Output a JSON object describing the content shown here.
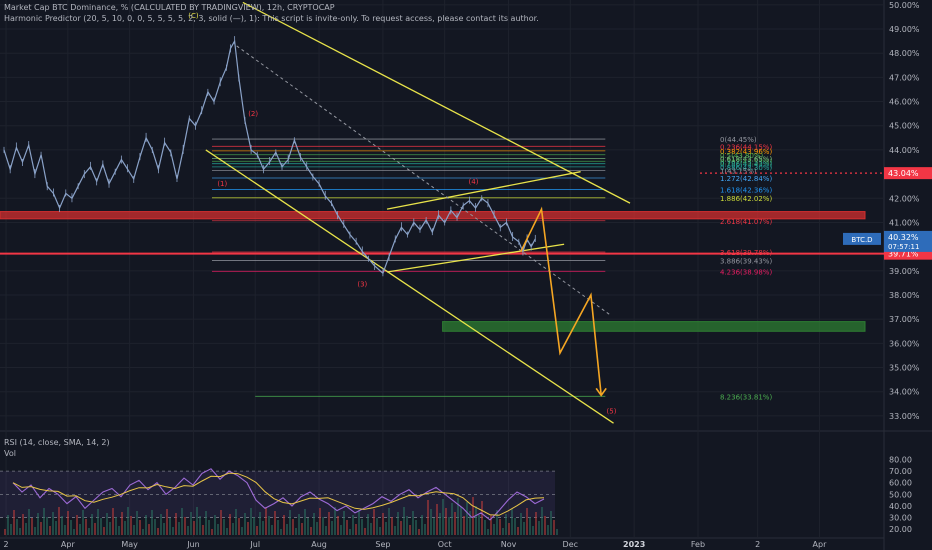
{
  "header": {
    "title": "Market Cap BTC Dominance, % (CALCULATED BY TRADINGVIEW), 12h, CRYPTOCAP",
    "indicator": "Harmonic Predictor (20, 5, 10, 0, 0, 5, 5, 5, 5, 2, 3, solid (—), 1): This script is invite-only. To request access, please contact its author.",
    "rsi_label": "RSI (14, close, SMA, 14, 2)",
    "vol_label": "Vol"
  },
  "colors": {
    "background": "#131722",
    "grid": "#1e222d",
    "price_line": "#8aa2c8",
    "channel": "#e8e34a",
    "projection": "#f5a623",
    "resistance_zone": "#d32f2f",
    "support_zone": "#2e7d32",
    "current_price_tag": "#2e6cba",
    "alert_line": "#f23645",
    "rsi_line": "#9c6ad6",
    "rsi_ma": "#e8c547"
  },
  "chart_data": {
    "type": "line",
    "symbol": "BTC.D",
    "timeframe": "12h",
    "price_axis": {
      "min": 32.5,
      "max": 50.2,
      "ticks": [
        "50.00%",
        "49.00%",
        "48.00%",
        "47.00%",
        "46.00%",
        "45.00%",
        "44.00%",
        "42.00%",
        "41.00%",
        "39.00%",
        "38.00%",
        "37.00%",
        "36.00%",
        "35.00%",
        "34.00%",
        "33.00%"
      ]
    },
    "time_axis": {
      "labels": [
        "2",
        "Apr",
        "May",
        "Jun",
        "Jul",
        "Aug",
        "Sep",
        "Oct",
        "Nov",
        "Dec",
        "2023",
        "Feb",
        "2",
        "Apr"
      ]
    },
    "current_price": {
      "label": "BTC.D",
      "value": "40.32%",
      "countdown": "07:57:11",
      "y": 40.32
    },
    "tagged_levels": [
      {
        "value": "43.04%",
        "y": 43.04,
        "style": "dotted-red"
      },
      {
        "value": "39.71%",
        "y": 39.71,
        "style": "solid-red"
      }
    ],
    "fib_levels": [
      {
        "label": "0(44.45%)",
        "y": 44.45,
        "color": "#9598a1"
      },
      {
        "label": "0.236(44.15%)",
        "y": 44.15,
        "color": "#f23645"
      },
      {
        "label": "0.382(43.96%)",
        "y": 43.96,
        "color": "#ff9800"
      },
      {
        "label": "0.5(43.80%)",
        "y": 43.8,
        "color": "#4caf50"
      },
      {
        "label": "0.618(43.65%)",
        "y": 43.65,
        "color": "#81c784"
      },
      {
        "label": "0.707(43.53%)",
        "y": 43.53,
        "color": "#4caf50"
      },
      {
        "label": "0.786(43.43%)",
        "y": 43.43,
        "color": "#26a69a"
      },
      {
        "label": "0.886(43.30%)",
        "y": 43.3,
        "color": "#26a69a"
      },
      {
        "label": "1(43.15%)",
        "y": 43.15,
        "color": "#9598a1"
      },
      {
        "label": "1.272(42.84%)",
        "y": 42.84,
        "color": "#42a5f5"
      },
      {
        "label": "1.618(42.36%)",
        "y": 42.36,
        "color": "#2196f3"
      },
      {
        "label": "1.886(42.02%)",
        "y": 42.02,
        "color": "#cddc39"
      },
      {
        "label": "2.618(41.07%)",
        "y": 41.07,
        "color": "#f23645"
      },
      {
        "label": "3.618(39.78%)",
        "y": 39.78,
        "color": "#f23645"
      },
      {
        "label": "3.886(39.43%)",
        "y": 39.43,
        "color": "#9598a1"
      },
      {
        "label": "4.236(38.98%)",
        "y": 38.98,
        "color": "#e91e63"
      },
      {
        "label": "8.236(33.81%)",
        "y": 33.81,
        "color": "#4caf50"
      }
    ],
    "zones": [
      {
        "name": "resistance",
        "y_top": 41.45,
        "y_bottom": 41.15,
        "color": "#d32f2f"
      },
      {
        "name": "support",
        "y_top": 36.9,
        "y_bottom": 36.5,
        "color": "#2e7d32"
      }
    ],
    "wave_labels": [
      {
        "label": "(C)",
        "x_date": "2022-06-01",
        "y": 49.45,
        "color": "#e8e34a"
      },
      {
        "label": "(2)",
        "x_date": "2022-06-30",
        "y": 45.4,
        "color": "#f23645"
      },
      {
        "label": "(1)",
        "x_date": "2022-06-15",
        "y": 42.5,
        "color": "#f23645"
      },
      {
        "label": "(4)",
        "x_date": "2022-10-15",
        "y": 42.6,
        "color": "#f23645"
      },
      {
        "label": "(3)",
        "x_date": "2022-08-22",
        "y": 38.35,
        "color": "#f23645"
      },
      {
        "label": "(5)",
        "x_date": "2022-12-21",
        "y": 33.1,
        "color": "#f23645"
      }
    ],
    "channel_lines": [
      {
        "name": "upper",
        "points": [
          [
            "2022-06-25",
            50.1
          ],
          [
            "2022-12-30",
            41.8
          ]
        ]
      },
      {
        "name": "lower",
        "points": [
          [
            "2022-06-07",
            44.0
          ],
          [
            "2022-12-22",
            32.7
          ]
        ]
      },
      {
        "name": "inner-lower",
        "points": [
          [
            "2022-09-03",
            38.95
          ],
          [
            "2022-11-28",
            40.1
          ]
        ]
      },
      {
        "name": "inner-upper",
        "points": [
          [
            "2022-09-03",
            41.55
          ],
          [
            "2022-12-06",
            43.1
          ]
        ]
      }
    ],
    "projection_path": [
      [
        "2022-11-07",
        39.8
      ],
      [
        "2022-11-17",
        41.55
      ],
      [
        "2022-11-26",
        35.6
      ],
      [
        "2022-12-11",
        38.0
      ],
      [
        "2022-12-16",
        33.85
      ]
    ],
    "price_series": [
      [
        "2022-03-01",
        44.0
      ],
      [
        "2022-03-04",
        43.2
      ],
      [
        "2022-03-07",
        44.1
      ],
      [
        "2022-03-10",
        43.5
      ],
      [
        "2022-03-13",
        44.2
      ],
      [
        "2022-03-16",
        43.0
      ],
      [
        "2022-03-19",
        43.8
      ],
      [
        "2022-03-22",
        42.5
      ],
      [
        "2022-03-25",
        42.2
      ],
      [
        "2022-03-28",
        41.6
      ],
      [
        "2022-03-31",
        42.2
      ],
      [
        "2022-04-03",
        42.0
      ],
      [
        "2022-04-06",
        42.5
      ],
      [
        "2022-04-09",
        43.0
      ],
      [
        "2022-04-12",
        43.3
      ],
      [
        "2022-04-15",
        42.7
      ],
      [
        "2022-04-18",
        43.4
      ],
      [
        "2022-04-21",
        42.6
      ],
      [
        "2022-04-24",
        43.1
      ],
      [
        "2022-04-27",
        43.6
      ],
      [
        "2022-04-30",
        43.2
      ],
      [
        "2022-05-03",
        42.8
      ],
      [
        "2022-05-06",
        43.7
      ],
      [
        "2022-05-09",
        44.5
      ],
      [
        "2022-05-12",
        44.0
      ],
      [
        "2022-05-15",
        43.2
      ],
      [
        "2022-05-18",
        44.3
      ],
      [
        "2022-05-21",
        43.9
      ],
      [
        "2022-05-24",
        42.8
      ],
      [
        "2022-05-27",
        44.0
      ],
      [
        "2022-05-30",
        45.3
      ],
      [
        "2022-06-02",
        45.0
      ],
      [
        "2022-06-05",
        45.6
      ],
      [
        "2022-06-08",
        46.4
      ],
      [
        "2022-06-11",
        46.0
      ],
      [
        "2022-06-14",
        46.8
      ],
      [
        "2022-06-17",
        47.4
      ],
      [
        "2022-06-19",
        48.2
      ],
      [
        "2022-06-21",
        48.5
      ],
      [
        "2022-06-23",
        47.0
      ],
      [
        "2022-06-26",
        45.2
      ],
      [
        "2022-06-29",
        44.0
      ],
      [
        "2022-07-02",
        43.8
      ],
      [
        "2022-07-05",
        43.2
      ],
      [
        "2022-07-08",
        43.5
      ],
      [
        "2022-07-11",
        43.9
      ],
      [
        "2022-07-14",
        43.3
      ],
      [
        "2022-07-17",
        43.6
      ],
      [
        "2022-07-20",
        44.4
      ],
      [
        "2022-07-23",
        43.7
      ],
      [
        "2022-07-26",
        43.3
      ],
      [
        "2022-07-29",
        42.9
      ],
      [
        "2022-08-01",
        42.6
      ],
      [
        "2022-08-04",
        42.1
      ],
      [
        "2022-08-07",
        41.8
      ],
      [
        "2022-08-10",
        41.3
      ],
      [
        "2022-08-13",
        40.9
      ],
      [
        "2022-08-16",
        40.5
      ],
      [
        "2022-08-19",
        40.2
      ],
      [
        "2022-08-22",
        39.8
      ],
      [
        "2022-08-25",
        39.5
      ],
      [
        "2022-08-28",
        39.2
      ],
      [
        "2022-09-01",
        38.9
      ],
      [
        "2022-09-04",
        39.6
      ],
      [
        "2022-09-07",
        40.3
      ],
      [
        "2022-09-10",
        40.8
      ],
      [
        "2022-09-13",
        40.5
      ],
      [
        "2022-09-16",
        41.0
      ],
      [
        "2022-09-19",
        40.7
      ],
      [
        "2022-09-22",
        41.1
      ],
      [
        "2022-09-25",
        40.6
      ],
      [
        "2022-09-28",
        41.3
      ],
      [
        "2022-10-01",
        41.0
      ],
      [
        "2022-10-04",
        41.5
      ],
      [
        "2022-10-07",
        41.2
      ],
      [
        "2022-10-10",
        41.7
      ],
      [
        "2022-10-13",
        41.9
      ],
      [
        "2022-10-16",
        41.6
      ],
      [
        "2022-10-19",
        42.0
      ],
      [
        "2022-10-22",
        41.8
      ],
      [
        "2022-10-25",
        41.3
      ],
      [
        "2022-10-28",
        40.8
      ],
      [
        "2022-10-31",
        41.0
      ],
      [
        "2022-11-03",
        40.4
      ],
      [
        "2022-11-06",
        40.2
      ],
      [
        "2022-11-08",
        39.8
      ],
      [
        "2022-11-10",
        40.3
      ],
      [
        "2022-11-12",
        40.0
      ],
      [
        "2022-11-14",
        40.32
      ]
    ],
    "rsi": {
      "axis_ticks": [
        "80.00",
        "70.00",
        "60.00",
        "50.00",
        "40.00",
        "30.00",
        "20.00"
      ],
      "min": 15,
      "max": 83,
      "series": [
        [
          3,
          60
        ],
        [
          6,
          52
        ],
        [
          9,
          58
        ],
        [
          12,
          47
        ],
        [
          15,
          55
        ],
        [
          18,
          50
        ],
        [
          21,
          42
        ],
        [
          24,
          48
        ],
        [
          27,
          38
        ],
        [
          30,
          45
        ],
        [
          33,
          52
        ],
        [
          36,
          55
        ],
        [
          39,
          48
        ],
        [
          42,
          58
        ],
        [
          45,
          62
        ],
        [
          48,
          54
        ],
        [
          51,
          60
        ],
        [
          54,
          50
        ],
        [
          57,
          56
        ],
        [
          60,
          64
        ],
        [
          63,
          58
        ],
        [
          66,
          68
        ],
        [
          69,
          72
        ],
        [
          72,
          63
        ],
        [
          75,
          70
        ],
        [
          78,
          66
        ],
        [
          81,
          60
        ],
        [
          84,
          45
        ],
        [
          87,
          38
        ],
        [
          90,
          42
        ],
        [
          93,
          47
        ],
        [
          96,
          40
        ],
        [
          99,
          48
        ],
        [
          102,
          52
        ],
        [
          105,
          46
        ],
        [
          108,
          42
        ],
        [
          111,
          36
        ],
        [
          114,
          40
        ],
        [
          117,
          34
        ],
        [
          120,
          38
        ],
        [
          123,
          42
        ],
        [
          126,
          48
        ],
        [
          129,
          44
        ],
        [
          132,
          50
        ],
        [
          135,
          54
        ],
        [
          138,
          47
        ],
        [
          141,
          52
        ],
        [
          144,
          56
        ],
        [
          147,
          50
        ],
        [
          150,
          44
        ],
        [
          153,
          38
        ],
        [
          156,
          30
        ],
        [
          159,
          34
        ],
        [
          162,
          28
        ],
        [
          165,
          36
        ],
        [
          168,
          45
        ],
        [
          171,
          52
        ],
        [
          174,
          48
        ],
        [
          177,
          42
        ],
        [
          180,
          46
        ]
      ]
    }
  }
}
